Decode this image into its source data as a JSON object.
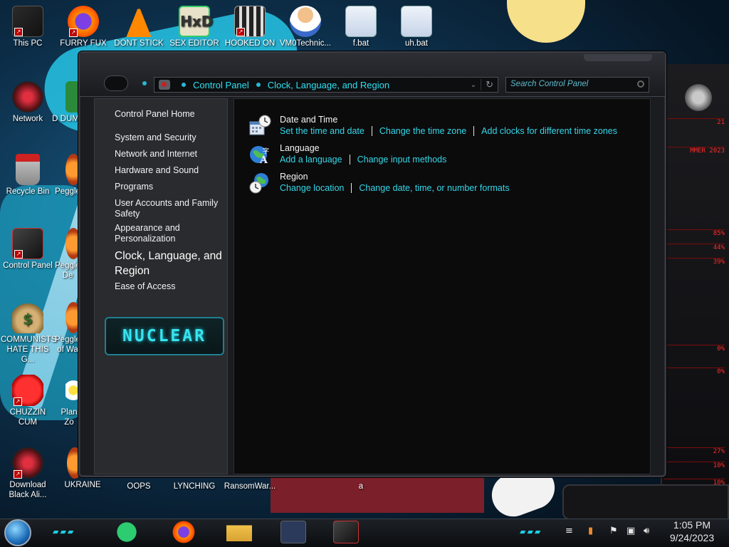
{
  "desktop": {
    "icons": [
      {
        "label": "This PC",
        "icon": "computer-icon"
      },
      {
        "label": "FURRY FUX",
        "icon": "firefox-icon"
      },
      {
        "label": "DONT STICK",
        "icon": "vlc-icon"
      },
      {
        "label": "SEX EDITOR",
        "icon": "hex-editor-icon"
      },
      {
        "label": "HOOKED ON",
        "icon": "maze-icon"
      },
      {
        "label": "VM0Technic...",
        "icon": "doctor-icon"
      },
      {
        "label": "f.bat",
        "icon": "batch-file-icon"
      },
      {
        "label": "uh.bat",
        "icon": "batch-file-icon"
      },
      {
        "label": "Network",
        "icon": "network-icon"
      },
      {
        "label": "Recycle Bin",
        "icon": "recycle-bin-icon"
      },
      {
        "label": "Control Panel",
        "icon": "control-panel-icon"
      },
      {
        "label": "COMMUNISTS HATE THIS G...",
        "icon": "money-bag-icon"
      },
      {
        "label": "CHUZZIN CUM",
        "icon": "chuzzle-icon"
      },
      {
        "label": "Download Black Ali...",
        "icon": "alienware-icon"
      },
      {
        "label": "D DUM",
        "icon": "app-icon"
      },
      {
        "label": "Peggle",
        "icon": "peggle-icon"
      },
      {
        "label": "Peggle De",
        "icon": "peggle-icon"
      },
      {
        "label": "Peggle of Wa",
        "icon": "peggle-icon"
      },
      {
        "label": "Plan Zo",
        "icon": "flower-icon"
      },
      {
        "label": "UKRAINE",
        "icon": "peggle-icon"
      },
      {
        "label": "OOPS",
        "icon": "app-icon"
      },
      {
        "label": "LYNCHING",
        "icon": "app-icon"
      },
      {
        "label": "RansomWar...",
        "icon": "app-icon"
      },
      {
        "label": "a",
        "icon": "app-icon"
      }
    ]
  },
  "window": {
    "breadcrumb": [
      "Control Panel",
      "Clock, Language, and Region"
    ],
    "search_placeholder": "Search Control Panel",
    "left_nav": {
      "home": "Control Panel Home",
      "items": [
        "System and Security",
        "Network and Internet",
        "Hardware and Sound",
        "Programs",
        "User Accounts and Family Safety",
        "Appearance and Personalization",
        "Clock, Language, and Region",
        "Ease of Access"
      ],
      "banner": "NUCLEAR"
    },
    "categories": [
      {
        "title": "Date and Time",
        "icon": "clock-calendar-icon",
        "links": [
          "Set the time and date",
          "Change the time zone",
          "Add clocks for different time zones"
        ]
      },
      {
        "title": "Language",
        "icon": "globe-language-icon",
        "links": [
          "Add a language",
          "Change input methods"
        ]
      },
      {
        "title": "Region",
        "icon": "globe-clock-icon",
        "links": [
          "Change location",
          "Change date, time, or number formats"
        ]
      }
    ]
  },
  "gadget": {
    "lines": [
      "21",
      "MMER 2023",
      "",
      "85%",
      "44%",
      "39%",
      "",
      "0%",
      "0%",
      "",
      "27%",
      "10%",
      "10%"
    ]
  },
  "taskbar": {
    "apps": [
      "spotify-icon",
      "firefox-icon",
      "file-explorer-icon",
      "network-card-icon",
      "control-panel-icon"
    ],
    "clock_time": "1:05 PM",
    "clock_date": "9/24/2023"
  },
  "colors": {
    "accent": "#36d7e8",
    "window_bg": "#1b1c1f",
    "content_bg": "#0b0b0c",
    "gadget_red": "#ff2a2a"
  }
}
